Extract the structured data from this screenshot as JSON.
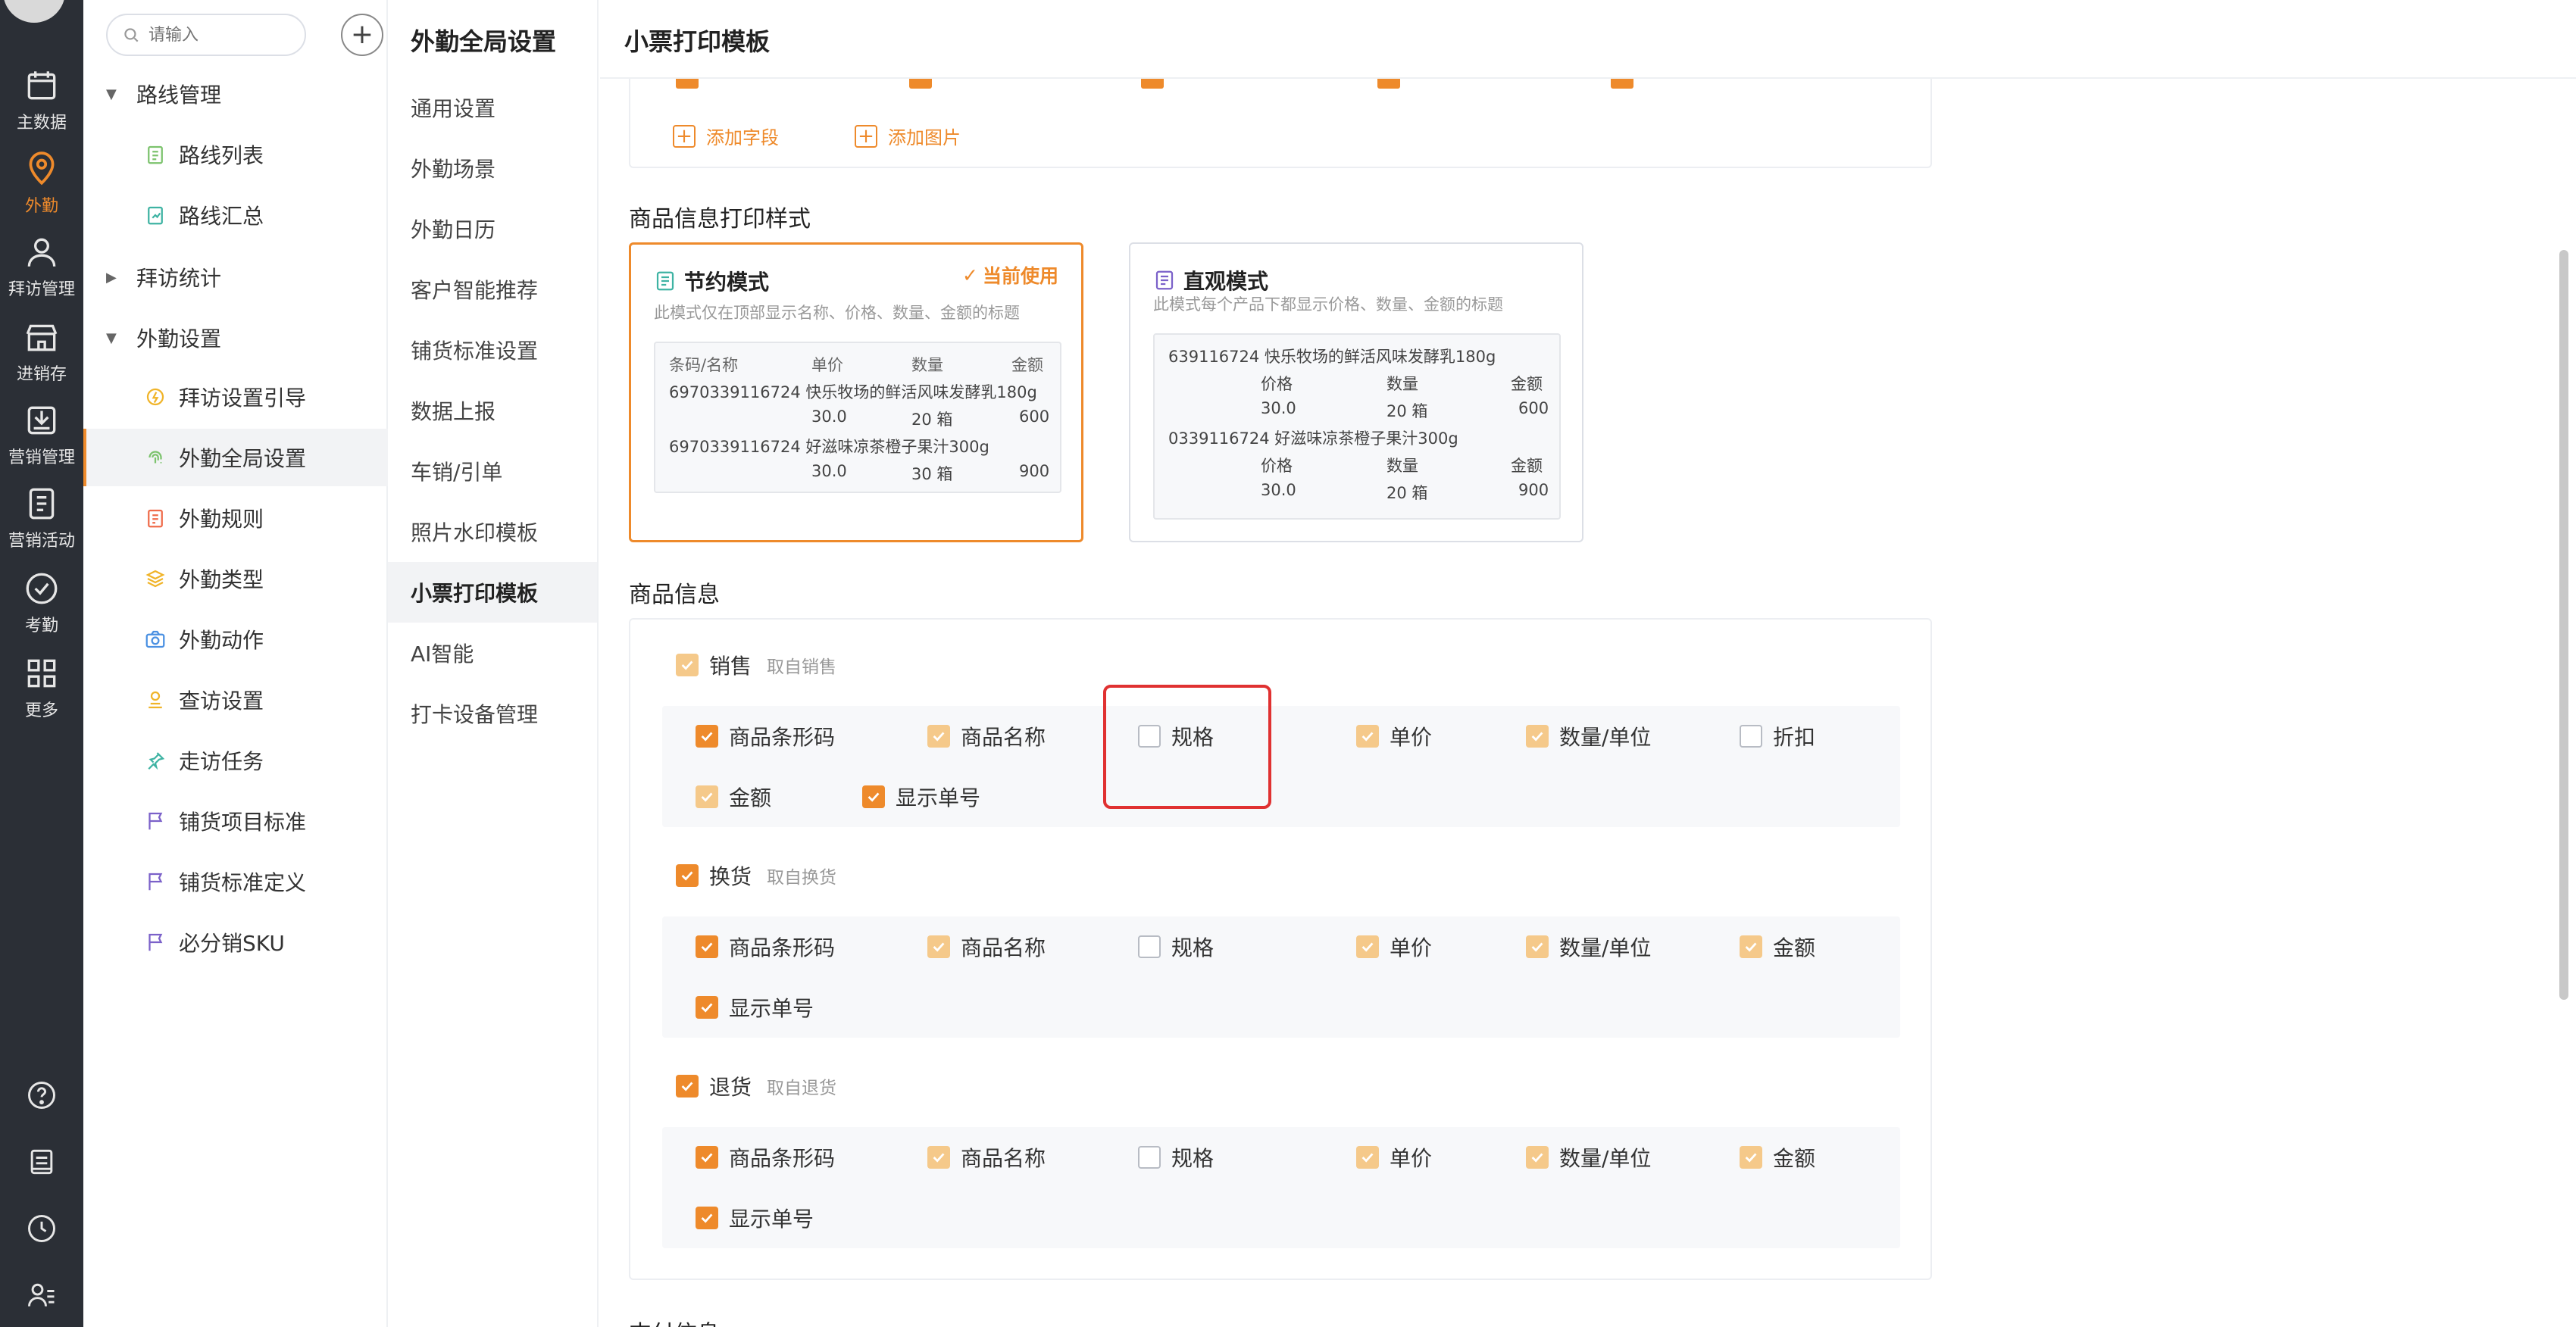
{
  "rail": {
    "items": [
      {
        "label": "主数据",
        "icon": "main-data-icon"
      },
      {
        "label": "外勤",
        "icon": "location-pin-icon",
        "active": true
      },
      {
        "label": "拜访管理",
        "icon": "person-icon"
      },
      {
        "label": "进销存",
        "icon": "store-icon"
      },
      {
        "label": "营销管理",
        "icon": "marketing-icon"
      },
      {
        "label": "营销活动",
        "icon": "activity-icon"
      },
      {
        "label": "考勤",
        "icon": "check-circle-icon"
      },
      {
        "label": "更多",
        "icon": "grid-icon"
      }
    ]
  },
  "sidebar": {
    "search_placeholder": "请输入",
    "groups": {
      "route": "路线管理",
      "visit_stats": "拜访统计",
      "field_settings": "外勤设置"
    },
    "items": {
      "route_list": "路线列表",
      "route_summary": "路线汇总",
      "visit_guide": "拜访设置引导",
      "field_global": "外勤全局设置",
      "field_rules": "外勤规则",
      "field_types": "外勤类型",
      "field_actions": "外勤动作",
      "check_settings": "查访设置",
      "visit_tasks": "走访任务",
      "display_item_std": "铺货项目标准",
      "display_std_def": "铺货标准定义",
      "must_sell_sku": "必分销SKU"
    }
  },
  "submenu": {
    "title": "外勤全局设置",
    "items": [
      "通用设置",
      "外勤场景",
      "外勤日历",
      "客户智能推荐",
      "铺货标准设置",
      "数据上报",
      "车销/引单",
      "照片水印模板",
      "小票打印模板",
      "AI智能",
      "打卡设备管理"
    ]
  },
  "main": {
    "title": "小票打印模板",
    "add_field": "添加字段",
    "add_image": "添加图片",
    "print_style_title": "商品信息打印样式",
    "product_info_title": "商品信息",
    "next_section_partial": "支付信息",
    "cards": {
      "economy": {
        "name": "节约模式",
        "desc": "此模式仅在顶部显示名称、价格、数量、金额的标题",
        "current": "当前使用",
        "header": [
          "条码/名称",
          "单价",
          "数量",
          "金额"
        ],
        "rows": [
          {
            "name": "6970339116724 快乐牧场的鲜活风味发酵乳180g",
            "price": "30.0",
            "qty": "20 箱",
            "amount": "600"
          },
          {
            "name": "6970339116724 好滋味凉茶橙子果汁300g",
            "price": "30.0",
            "qty": "30 箱",
            "amount": "900"
          }
        ]
      },
      "visual": {
        "name": "直观模式",
        "desc": "此模式每个产品下都显示价格、数量、金额的标题",
        "sub_header": [
          "价格",
          "数量",
          "金额"
        ],
        "rows": [
          {
            "name": "639116724  快乐牧场的鲜活风味发酵乳180g",
            "price": "30.0",
            "qty": "20 箱",
            "amount": "600"
          },
          {
            "name": "0339116724 好滋味凉茶橙子果汁300g",
            "price": "30.0",
            "qty": "20 箱",
            "amount": "900"
          }
        ]
      }
    },
    "groups": {
      "sales": {
        "label": "销售",
        "hint": "取自销售",
        "options": [
          "商品条形码",
          "商品名称",
          "规格",
          "单价",
          "数量/单位",
          "折扣",
          "金额",
          "显示单号"
        ]
      },
      "exchange": {
        "label": "换货",
        "hint": "取自换货",
        "options": [
          "商品条形码",
          "商品名称",
          "规格",
          "单价",
          "数量/单位",
          "金额",
          "显示单号"
        ]
      },
      "return": {
        "label": "退货",
        "hint": "取自退货",
        "options": [
          "商品条形码",
          "商品名称",
          "规格",
          "单价",
          "数量/单位",
          "金额",
          "显示单号"
        ]
      }
    }
  },
  "colors": {
    "accent": "#ee8a2b",
    "accent_disabled": "#f5c98a",
    "rail_bg": "#2b2f36",
    "highlight": "#e03131"
  }
}
